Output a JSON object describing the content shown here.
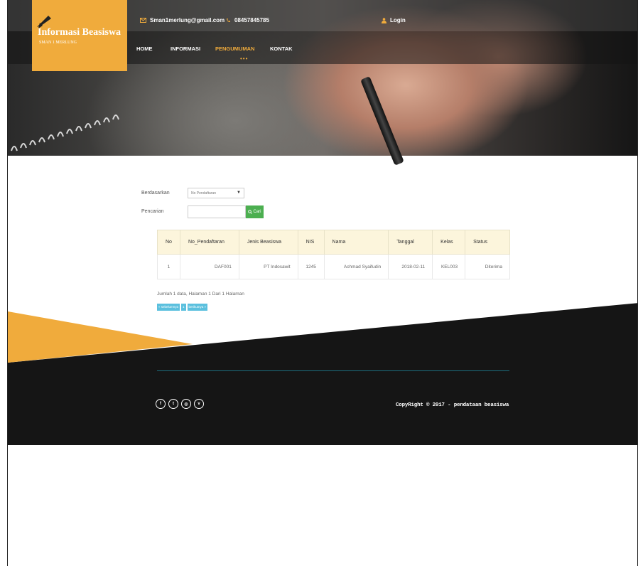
{
  "brand": {
    "title": "Informasi Beasiswa",
    "subtitle": "SMAN 1 MERLUNG"
  },
  "topbar": {
    "email": "Sman1merlung@gmail.com",
    "phone": "08457845785",
    "login": "Login"
  },
  "nav": {
    "items": [
      {
        "label": "HOME"
      },
      {
        "label": "INFORMASI"
      },
      {
        "label": "PENGUMUMAN",
        "active": true
      },
      {
        "label": "KONTAK"
      }
    ]
  },
  "filter": {
    "by_label": "Berdasarkan",
    "by_value": "No Pendaftaran",
    "search_label": "Pencarian",
    "search_value": "",
    "button": "Cari"
  },
  "table": {
    "headers": [
      "No",
      "No_Pendaftaran",
      "Jenis Beasiswa",
      "NIS",
      "Nama",
      "Tanggal",
      "Kelas",
      "Status"
    ],
    "rows": [
      [
        "1",
        "DAF001",
        "PT Indosawit",
        "1245",
        "Achmad Syaifudin",
        "2018-02-11",
        "KEL003",
        "Diterima"
      ]
    ]
  },
  "pagination": {
    "summary": "Jumlah 1 data, Halaman 1 Dari 1 Halaman",
    "prev": "« sebelumnya",
    "page": "1",
    "next": "berikutnya »"
  },
  "footer": {
    "copyright": "CopyRight © 2017 - pendataan beasiswa",
    "social_icons": [
      "facebook-icon",
      "twitter-icon",
      "instagram-icon",
      "vimeo-icon"
    ]
  },
  "colors": {
    "accent": "#f0ab3c",
    "footer_dark": "#151515",
    "search_button": "#4caf50",
    "pager": "#5bc0de"
  }
}
